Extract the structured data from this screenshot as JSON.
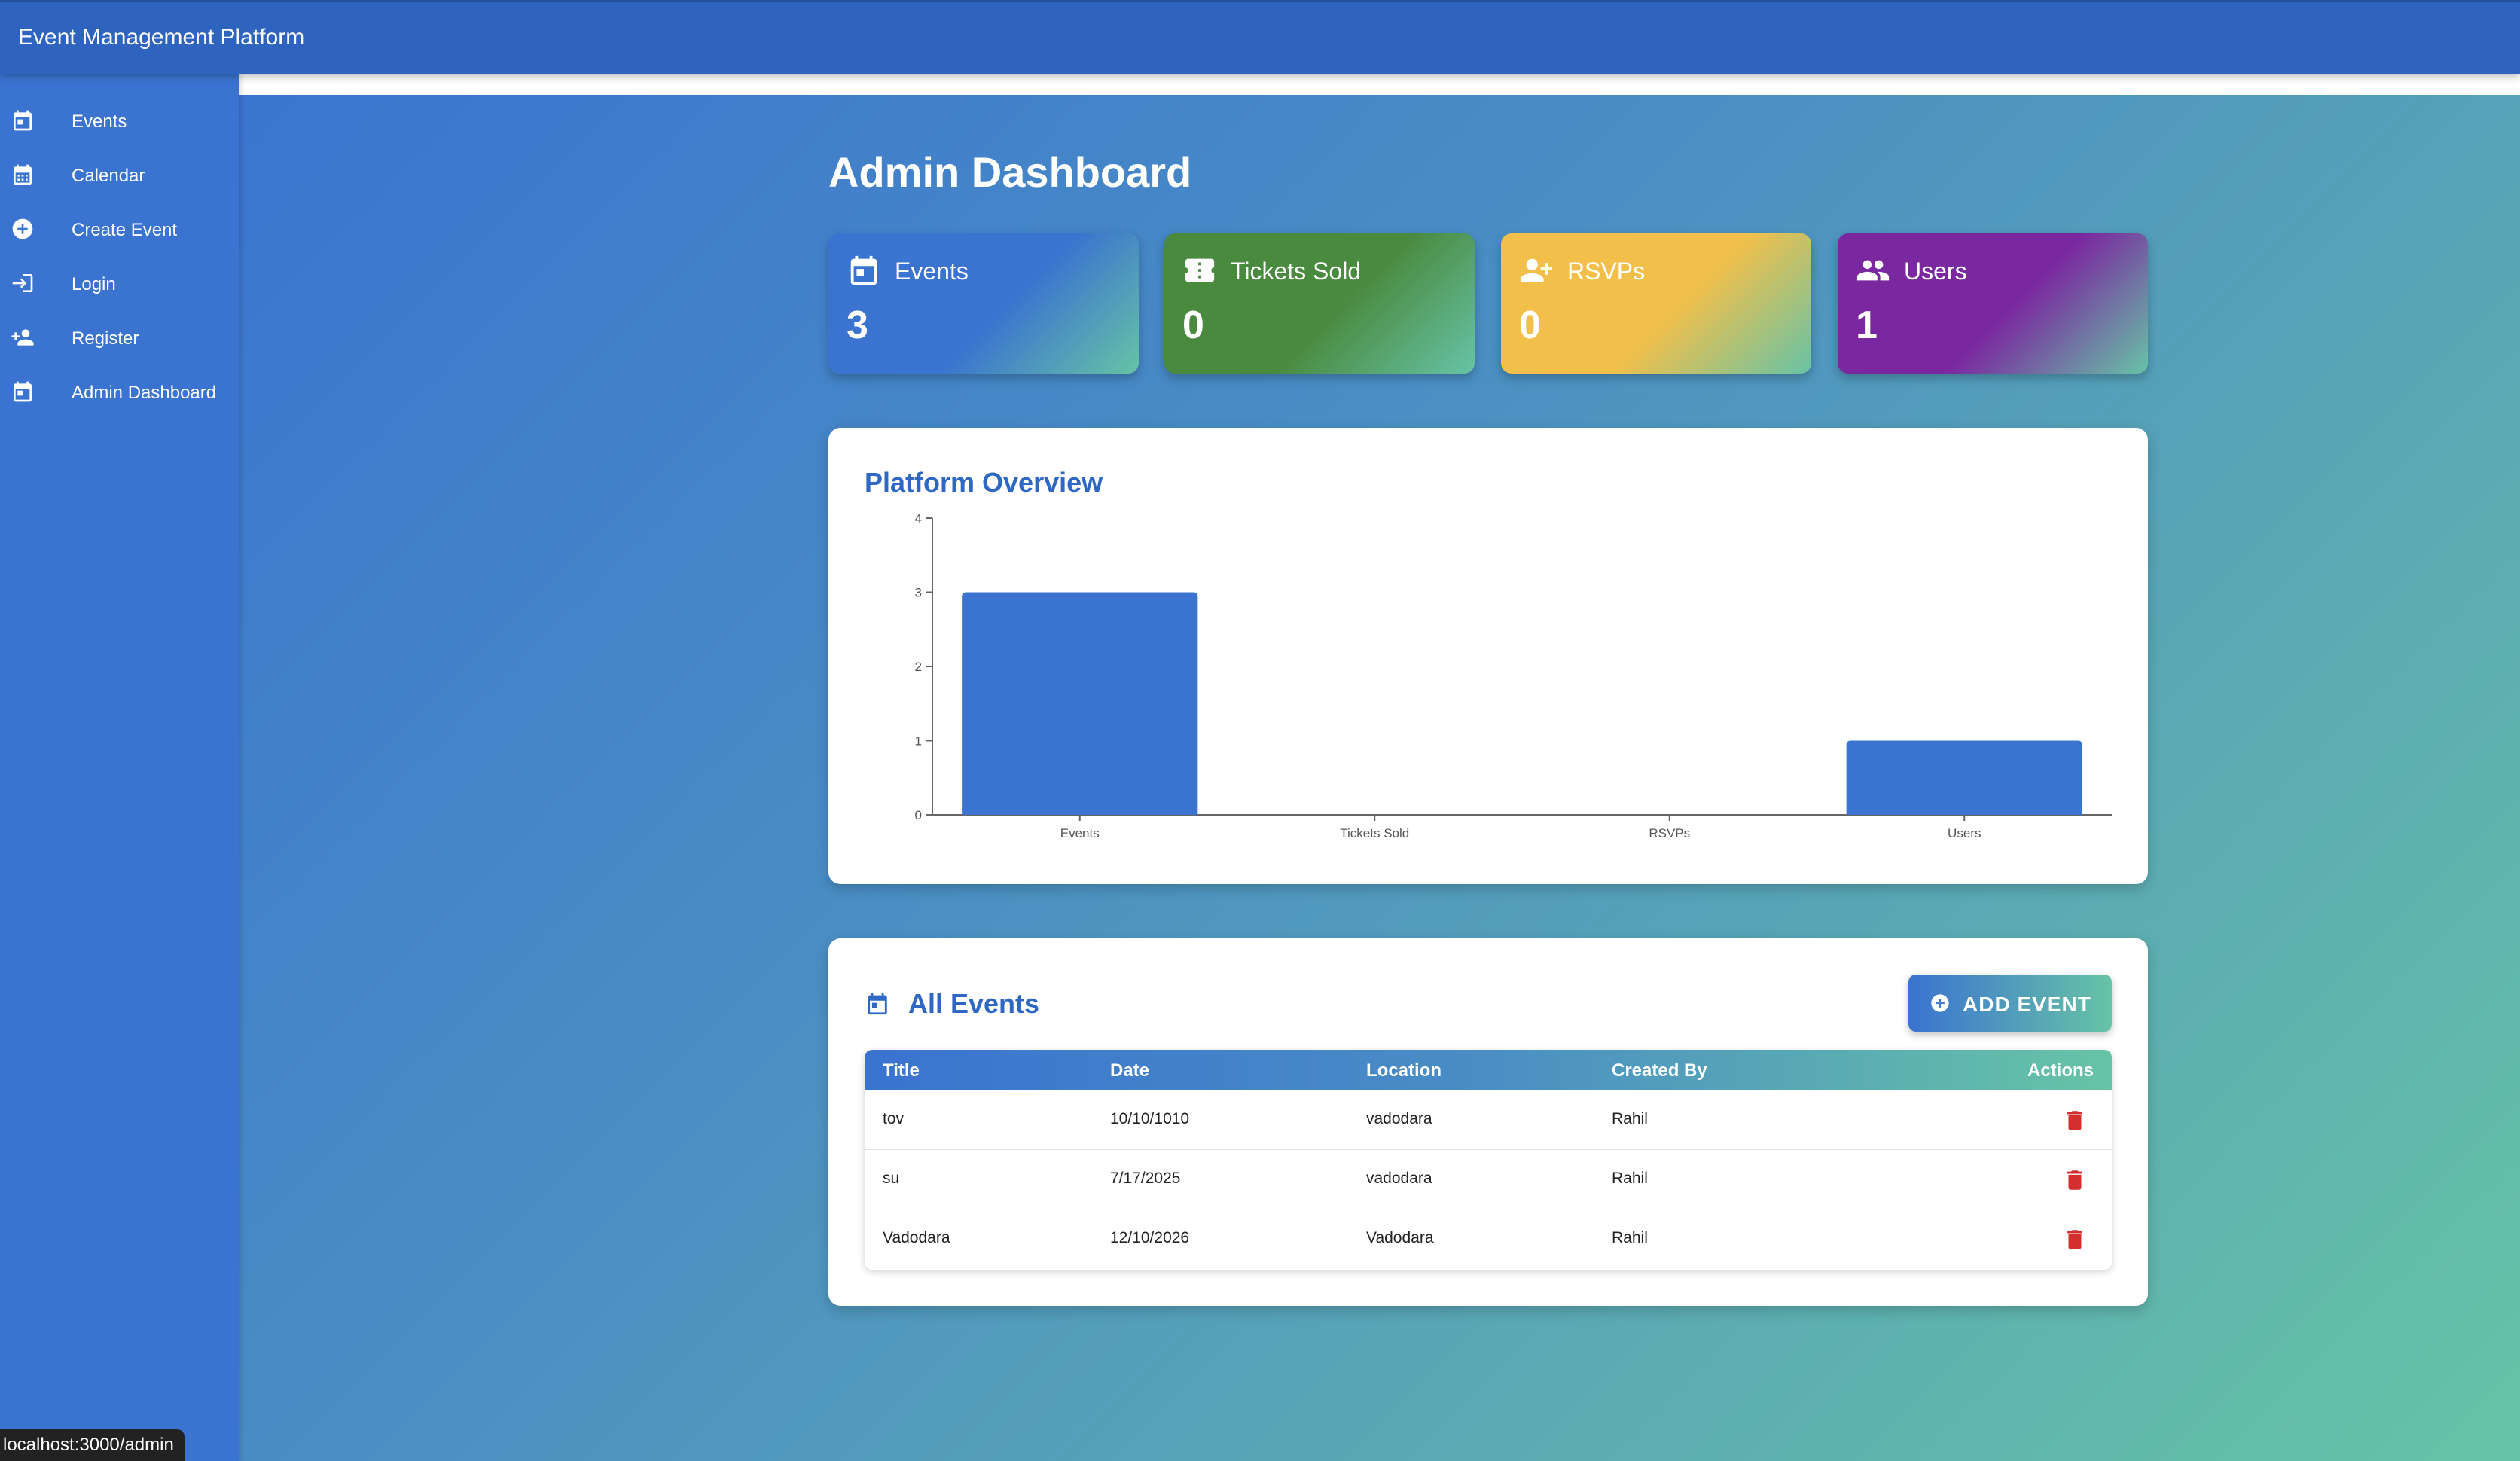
{
  "app": {
    "title": "Event Management Platform"
  },
  "sidebar": {
    "items": [
      {
        "label": "Events",
        "icon": "calendar-icon"
      },
      {
        "label": "Calendar",
        "icon": "calendar-month-icon"
      },
      {
        "label": "Create Event",
        "icon": "add-circle-icon"
      },
      {
        "label": "Login",
        "icon": "login-icon"
      },
      {
        "label": "Register",
        "icon": "person-add-icon"
      },
      {
        "label": "Admin Dashboard",
        "icon": "calendar-icon"
      }
    ]
  },
  "page": {
    "title": "Admin Dashboard"
  },
  "stats": [
    {
      "label": "Events",
      "value": "3",
      "icon": "calendar-icon",
      "color": "#3a73d0"
    },
    {
      "label": "Tickets Sold",
      "value": "0",
      "icon": "ticket-icon",
      "color": "#4a8a3f"
    },
    {
      "label": "RSVPs",
      "value": "0",
      "icon": "group-add-icon",
      "color": "#f2c04a"
    },
    {
      "label": "Users",
      "value": "1",
      "icon": "people-icon",
      "color": "#7a28a0"
    }
  ],
  "overview": {
    "title": "Platform Overview",
    "chart_data": {
      "type": "bar",
      "categories": [
        "Events",
        "Tickets Sold",
        "RSVPs",
        "Users"
      ],
      "values": [
        3,
        0,
        0,
        1
      ],
      "yticks": [
        "0",
        "1",
        "2",
        "3",
        "4"
      ],
      "ylim": [
        0,
        4
      ],
      "bar_color": "#3a73d0",
      "grid": false
    }
  },
  "events": {
    "title": "All Events",
    "add_button": "ADD EVENT",
    "columns": [
      "Title",
      "Date",
      "Location",
      "Created By",
      "Actions"
    ],
    "rows": [
      {
        "title": "tov",
        "date": "10/10/1010",
        "location": "vadodara",
        "created_by": "Rahil"
      },
      {
        "title": "su",
        "date": "7/17/2025",
        "location": "vadodara",
        "created_by": "Rahil"
      },
      {
        "title": "Vadodara",
        "date": "12/10/2026",
        "location": "Vadodara",
        "created_by": "Rahil"
      }
    ]
  },
  "statusbar": {
    "url": "localhost:3000/admin"
  },
  "colors": {
    "accent": "#2f67c4",
    "delete": "#d32f2f"
  }
}
